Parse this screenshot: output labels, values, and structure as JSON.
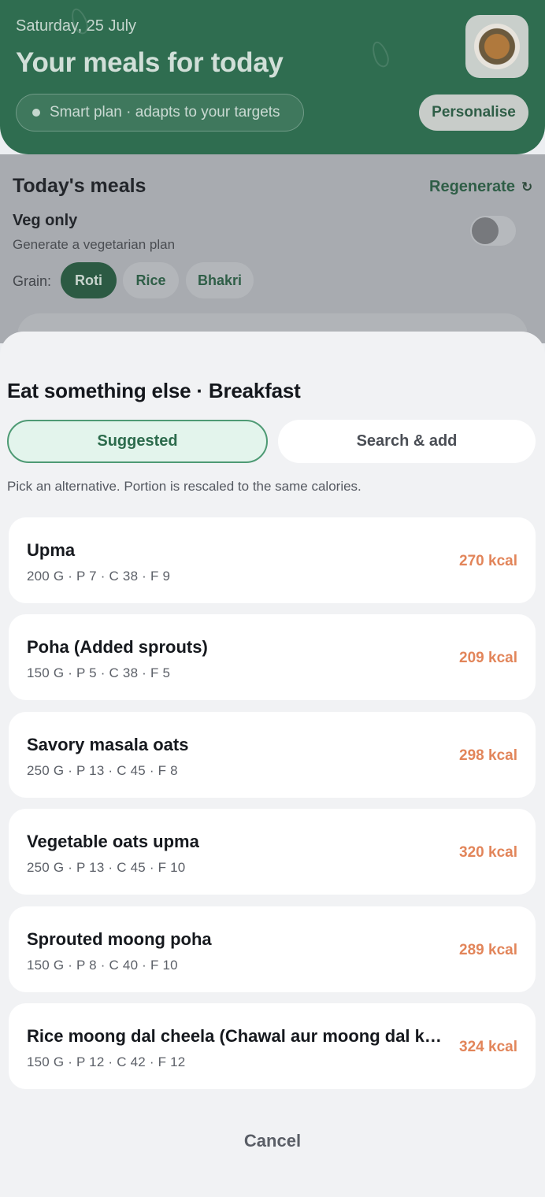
{
  "hero": {
    "date": "Saturday, 25 July",
    "title": "Your meals for today",
    "smart_plan": "Smart plan · adapts to your targets",
    "personalise_label": "Personalise"
  },
  "today": {
    "title": "Today's meals",
    "regenerate_label": "Regenerate",
    "veg_label": "Veg only",
    "veg_sub": "Generate a vegetarian plan",
    "grain_label": "Grain:",
    "grains": [
      "Roti",
      "Rice",
      "Bhakri"
    ],
    "selected_grain": "Roti"
  },
  "sheet": {
    "title": "Eat something else · Breakfast",
    "tabs": {
      "suggested": "Suggested",
      "search": "Search & add"
    },
    "active_tab": "Suggested",
    "hint": "Pick an alternative. Portion is rescaled to the same calories.",
    "meals": [
      {
        "name": "Upma",
        "meta": "200 G · P 7 · C 38 · F 9",
        "kcal": "270 kcal"
      },
      {
        "name": "Poha (Added sprouts)",
        "meta": "150 G · P 5 · C 38 · F 5",
        "kcal": "209 kcal"
      },
      {
        "name": "Savory masala oats",
        "meta": "250 G · P 13 · C 45 · F 8",
        "kcal": "298 kcal"
      },
      {
        "name": "Vegetable oats upma",
        "meta": "250 G · P 13 · C 45 · F 10",
        "kcal": "320 kcal"
      },
      {
        "name": "Sprouted moong poha",
        "meta": "150 G · P 8 · C 40 · F 10",
        "kcal": "289 kcal"
      },
      {
        "name": "Rice moong dal cheela (Chawal aur moong dal ka...",
        "meta": "150 G · P 12 · C 42 · F 12",
        "kcal": "324 kcal"
      }
    ],
    "cancel_label": "Cancel"
  },
  "colors": {
    "brand_green": "#2f6d50",
    "accent_kcal": "#e2855a",
    "suggested_bg": "#e3f4ec"
  }
}
